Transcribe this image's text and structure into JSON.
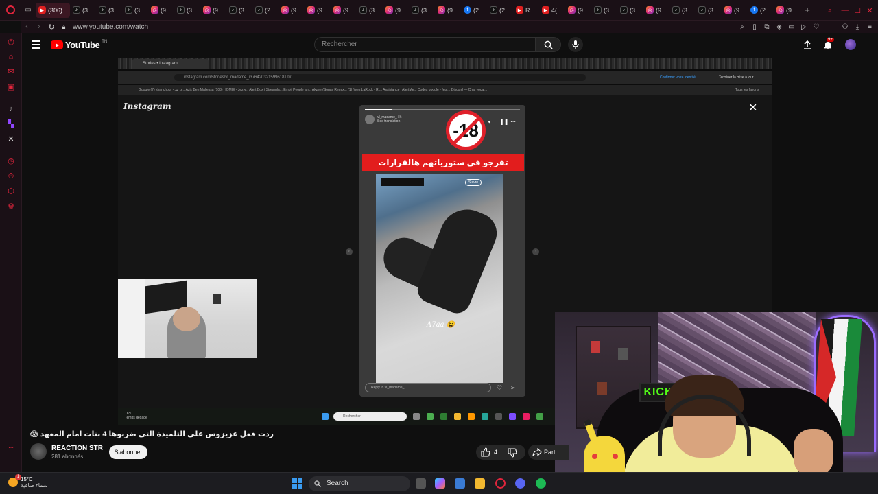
{
  "browser": {
    "active_tab_count": "(306)",
    "tabs": [
      {
        "icon": "tiktok",
        "count": "(3"
      },
      {
        "icon": "tiktok",
        "count": "(3"
      },
      {
        "icon": "tiktok",
        "count": "(3"
      },
      {
        "icon": "instagram",
        "count": "(9"
      },
      {
        "icon": "tiktok",
        "count": "(3"
      },
      {
        "icon": "instagram",
        "count": "(9"
      },
      {
        "icon": "tiktok",
        "count": "(3"
      },
      {
        "icon": "tiktok",
        "count": "(2"
      },
      {
        "icon": "instagram",
        "count": "(9"
      },
      {
        "icon": "instagram",
        "count": "(9"
      },
      {
        "icon": "instagram",
        "count": "(9"
      },
      {
        "icon": "tiktok",
        "count": "(3"
      },
      {
        "icon": "instagram",
        "count": "(9"
      },
      {
        "icon": "tiktok",
        "count": "(3"
      },
      {
        "icon": "instagram",
        "count": "(9"
      },
      {
        "icon": "facebook",
        "count": "(2"
      },
      {
        "icon": "tiktok",
        "count": "(2"
      },
      {
        "icon": "youtube",
        "count": "R"
      },
      {
        "icon": "youtube",
        "count": "4("
      },
      {
        "icon": "instagram",
        "count": "(9"
      },
      {
        "icon": "tiktok",
        "count": "(3"
      },
      {
        "icon": "tiktok",
        "count": "(3"
      },
      {
        "icon": "instagram",
        "count": "(9"
      },
      {
        "icon": "tiktok",
        "count": "(3"
      },
      {
        "icon": "tiktok",
        "count": "(3"
      },
      {
        "icon": "instagram",
        "count": "(9"
      },
      {
        "icon": "facebook",
        "count": "(2"
      },
      {
        "icon": "instagram",
        "count": "(9"
      }
    ],
    "url": "www.youtube.com/watch"
  },
  "youtube": {
    "logo_text": "YouTube",
    "logo_sup": "TN",
    "search_placeholder": "Rechercher",
    "notification_badge": "9+"
  },
  "video": {
    "inner_browser_tab": "Stories • Instagram",
    "inner_url": "instagram.com/stories/vl_madame_/3764203215996181/0/",
    "inner_buttons": [
      "Confirmer votre identité",
      "Terminer la mise à jour"
    ],
    "inner_bookmarks": "Google   (7) khanchour - درسـ...   Aziz Ben Mallessa   (108) HOMIE - Jezw...   Alert Box / Streamla...   Emoji People an...   Akzee (Songs Remix...   (1) Yves LaRock - Ri...   Assistance | AlertMe...   Codes google - fepi...   Discord — Chat vocal...",
    "inner_bookmarks_right": "Tous les favoris",
    "instagram_logo": "Instagram",
    "story_user": "vl_madame_",
    "story_time": "8h",
    "story_translation": "See translation",
    "age_badge": "-18",
    "banner_text": "تفرجو في ستورياتهم هالقرارات الملاهط",
    "follow_label": "Suivre",
    "clip_caption": "A7aa 😫",
    "reply_placeholder": "Reply to vl_madame_...",
    "inner_taskbar_temp": "16°C",
    "inner_taskbar_cond": "Temps dégagé",
    "inner_taskbar_search": "Rechercher",
    "facecam_sign": "KICK"
  },
  "meta": {
    "title": "ردت فعل عزيزوس على التلميذة التي ضربوها 4 بنات امام المعهد 😱",
    "channel_name": "REACTION STR",
    "subscribers": "281 abonnés",
    "subscribe_label": "S'abonner",
    "like_count": "4",
    "share_label": "Part"
  },
  "taskbar": {
    "temperature": "15°C",
    "condition": "سماء صافية",
    "search_label": "Search",
    "weather_badge": "1"
  }
}
